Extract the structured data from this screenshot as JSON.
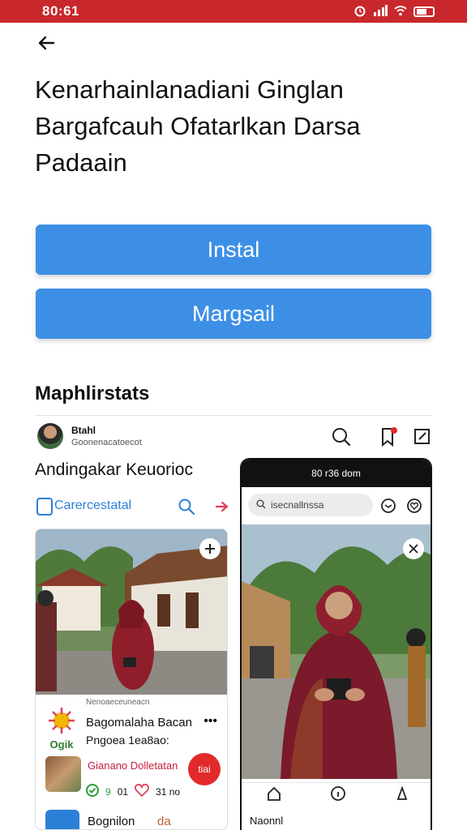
{
  "status_bar": {
    "time": "80:61",
    "alarm_icon": "alarm-icon",
    "signal_icon": "signal-icon",
    "wifi_icon": "wifi-icon",
    "battery_icon": "battery-icon"
  },
  "header": {
    "back_icon": "arrow-left-icon"
  },
  "title": "Kenarhainlanadiani Ginglan Bargafcauh Ofatarlkan Darsa Padaain",
  "buttons": {
    "install": "Instal",
    "margsail": "Margsail"
  },
  "section": {
    "heading": "Maphlirstats"
  },
  "profile": {
    "name": "Btahl",
    "sub": "Goonenacatoecot"
  },
  "left_column": {
    "heading": "Andingakar Keuorioc",
    "toolbar_label": "Carercestatal",
    "card": {
      "small": "Nenoaeceuneacn",
      "title": "Bagomalaha Bacan",
      "sub": "Pngoea 1ea8ao:",
      "logo_text": "Ogik",
      "gallery_label": "Gianano Dolletatan",
      "fab_label": "tiai",
      "stats": [
        "9",
        "01",
        "31 no"
      ],
      "bottom_label": "Bognilon",
      "bottom_num": "da"
    }
  },
  "phone": {
    "topbar": "80 r36 dom",
    "search_placeholder": "isecnallnssa",
    "user": "Naonnl"
  },
  "colors": {
    "status_bar": "#c8282c",
    "button": "#3d8fe6",
    "link": "#2b7fd6",
    "fab": "#e22a2a"
  }
}
